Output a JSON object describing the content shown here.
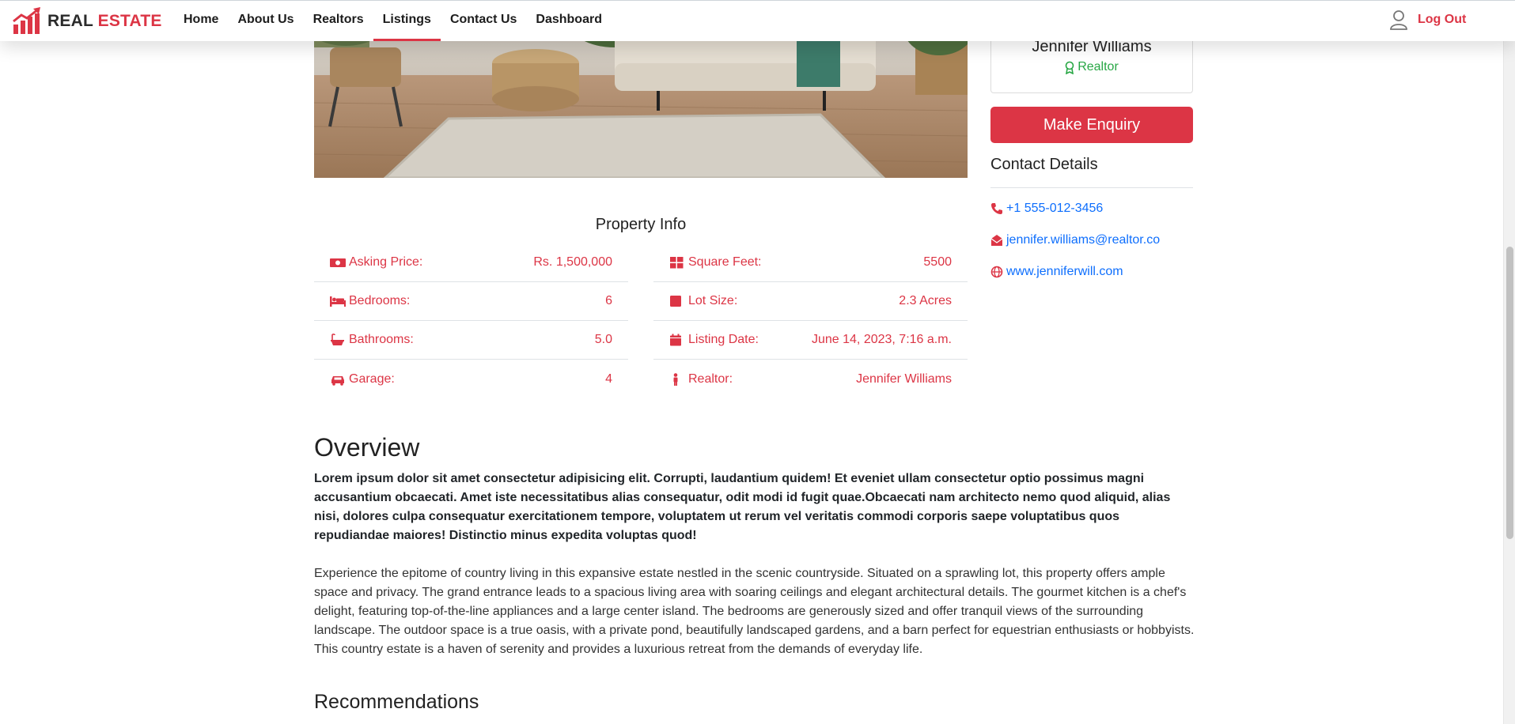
{
  "brand": {
    "part1": "REAL",
    "part2": "ESTATE"
  },
  "nav": {
    "items": [
      {
        "label": "Home"
      },
      {
        "label": "About Us"
      },
      {
        "label": "Realtors"
      },
      {
        "label": "Listings",
        "active": true
      },
      {
        "label": "Contact Us"
      },
      {
        "label": "Dashboard"
      }
    ],
    "logout": "Log Out"
  },
  "realtor": {
    "name": "Jennifer Williams",
    "role": "Realtor"
  },
  "enquiry_button": "Make Enquiry",
  "contact": {
    "title": "Contact Details",
    "phone": "+1 555-012-3456",
    "email": "jennifer.williams@realtor.co",
    "website": "www.jenniferwill.com"
  },
  "property_info": {
    "title": "Property Info",
    "left": [
      {
        "icon": "money-icon",
        "label": "Asking Price:",
        "value": "Rs. 1,500,000"
      },
      {
        "icon": "bed-icon",
        "label": "Bedrooms:",
        "value": "6"
      },
      {
        "icon": "bath-icon",
        "label": "Bathrooms:",
        "value": "5.0"
      },
      {
        "icon": "car-icon",
        "label": "Garage:",
        "value": "4"
      }
    ],
    "right": [
      {
        "icon": "grid-icon",
        "label": "Square Feet:",
        "value": "5500"
      },
      {
        "icon": "square-icon",
        "label": "Lot Size:",
        "value": "2.3 Acres"
      },
      {
        "icon": "calendar-icon",
        "label": "Listing Date:",
        "value": "June 14, 2023, 7:16 a.m."
      },
      {
        "icon": "person-icon",
        "label": "Realtor:",
        "value": "Jennifer Williams"
      }
    ]
  },
  "overview": {
    "title": "Overview",
    "lead": "Lorem ipsum dolor sit amet consectetur adipisicing elit. Corrupti, laudantium quidem! Et eveniet ullam consectetur optio possimus magni accusantium obcaecati. Amet iste necessitatibus alias consequatur, odit modi id fugit quae.Obcaecati nam architecto nemo quod aliquid, alias nisi, dolores culpa consequatur exercitationem tempore, voluptatem ut rerum vel veritatis commodi corporis saepe voluptatibus quos repudiandae maiores! Distinctio minus expedita voluptas quod!",
    "body": "Experience the epitome of country living in this expansive estate nestled in the scenic countryside. Situated on a sprawling lot, this property offers ample space and privacy. The grand entrance leads to a spacious living area with soaring ceilings and elegant architectural details. The gourmet kitchen is a chef's delight, featuring top-of-the-line appliances and a large center island. The bedrooms are generously sized and offer tranquil views of the surrounding landscape. The outdoor space is a true oasis, with a private pond, beautifully landscaped gardens, and a barn perfect for equestrian enthusiasts or hobbyists. This country estate is a haven of serenity and provides a luxurious retreat from the demands of everyday life."
  },
  "recommendations": {
    "title": "Recommendations"
  },
  "colors": {
    "accent": "#dc3545",
    "link": "#0d6efd",
    "success": "#28a745"
  }
}
